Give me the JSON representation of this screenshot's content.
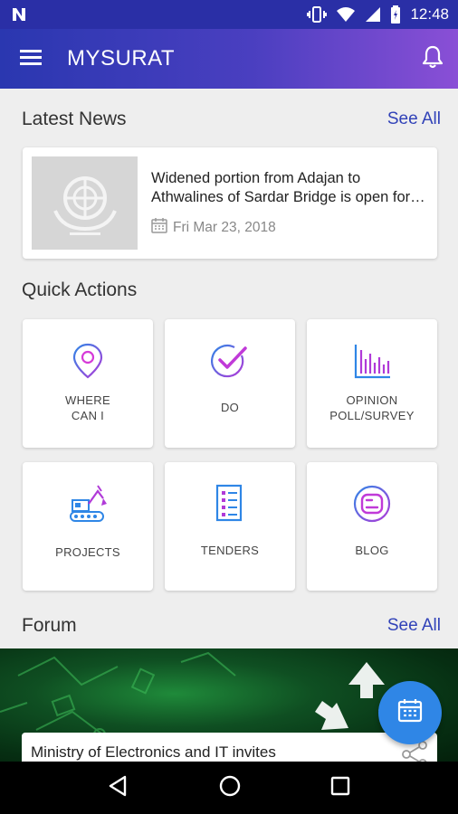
{
  "status_bar": {
    "notification_icon": "n-icon",
    "time": "12:48",
    "icons": [
      "vibrate-icon",
      "wifi-icon",
      "signal-icon",
      "battery-icon"
    ]
  },
  "app_bar": {
    "title": "MYSURAT",
    "menu_icon": "menu-icon",
    "bell_icon": "bell-icon",
    "accent": "#3142b8"
  },
  "latest_news": {
    "title": "Latest News",
    "see_all": "See All",
    "item": {
      "title": "Widened portion from Adajan to Athwalines of Sardar Bridge is open for traffic",
      "date": "Fri Mar 23, 2018"
    }
  },
  "quick_actions": {
    "title": "Quick Actions",
    "tiles": [
      {
        "label": "WHERE\nCAN I",
        "icon": "location-pin-icon"
      },
      {
        "label": "DO",
        "icon": "checkmark-icon"
      },
      {
        "label": "OPINION\nPOLL/SURVEY",
        "icon": "bar-chart-icon"
      },
      {
        "label": "PROJECTS",
        "icon": "excavator-icon"
      },
      {
        "label": "TENDERS",
        "icon": "document-list-icon"
      },
      {
        "label": "BLOG",
        "icon": "blogger-icon"
      }
    ]
  },
  "forum": {
    "title": "Forum",
    "see_all": "See All",
    "item_title": "Ministry of Electronics and IT invites"
  },
  "fab": {
    "icon": "calendar-icon",
    "color": "#2f86e6"
  },
  "nav_bar": {
    "icons": [
      "back-icon",
      "home-icon",
      "recents-icon"
    ]
  }
}
